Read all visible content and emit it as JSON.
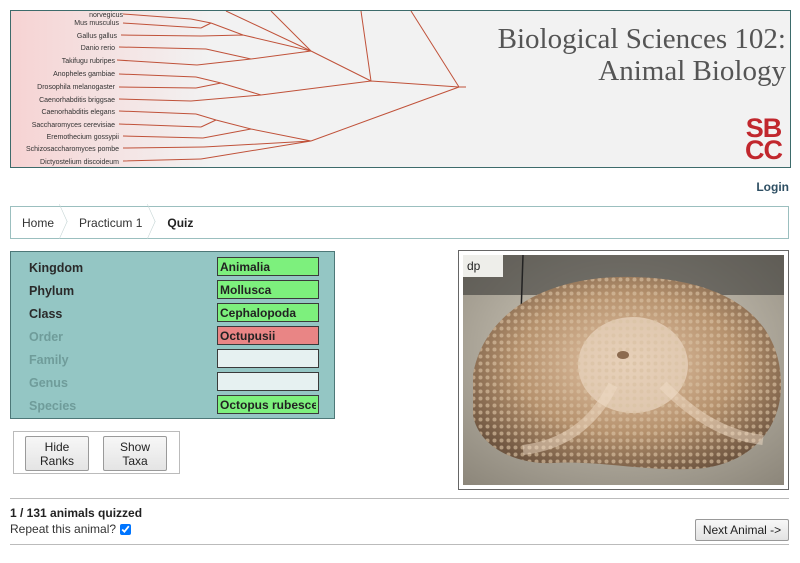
{
  "banner": {
    "title_line1": "Biological Sciences 102:",
    "title_line2": "Animal Biology",
    "logo_line1": "SB",
    "logo_line2": "CC",
    "species": [
      "norvegicus",
      "Mus musculus",
      "Gallus gallus",
      "Danio rerio",
      "Takifugu rubripes",
      "Anopheles gambiae",
      "Drosophila melanogaster",
      "Caenorhabditis briggsae",
      "Caenorhabditis elegans",
      "Saccharomyces cerevisiae",
      "Eremothecium gossypii",
      "Schizosaccharomyces pombe",
      "Dictyostelium discoideum"
    ]
  },
  "nav": {
    "login": "Login"
  },
  "breadcrumb": {
    "items": [
      {
        "label": "Home"
      },
      {
        "label": "Practicum 1"
      },
      {
        "label": "Quiz"
      }
    ]
  },
  "quiz": {
    "ranks": [
      {
        "label": "Kingdom",
        "value": "Animalia",
        "status": "correct"
      },
      {
        "label": "Phylum",
        "value": "Mollusca",
        "status": "correct"
      },
      {
        "label": "Class",
        "value": "Cephalopoda",
        "status": "correct"
      },
      {
        "label": "Order",
        "value": "Octupusii",
        "status": "wrong"
      },
      {
        "label": "Family",
        "value": "",
        "status": "empty"
      },
      {
        "label": "Genus",
        "value": "",
        "status": "empty"
      },
      {
        "label": "Species",
        "value": "Octopus rubescens",
        "status": "correct"
      }
    ],
    "hide_ranks_label": "Hide Ranks",
    "hide_ranks_line1": "Hide",
    "hide_ranks_line2": "Ranks",
    "show_taxa_line1": "Show",
    "show_taxa_line2": "Taxa"
  },
  "footer": {
    "progress": "1 / 131 animals quizzed",
    "repeat_label": "Repeat this animal?",
    "repeat_checked": true,
    "next_button": "Next Animal ->"
  },
  "colors": {
    "correct": "#7df07d",
    "wrong": "#e98585",
    "panel": "#94c6c4",
    "logo": "#c1272d",
    "tree_lines": "#c0523a"
  }
}
